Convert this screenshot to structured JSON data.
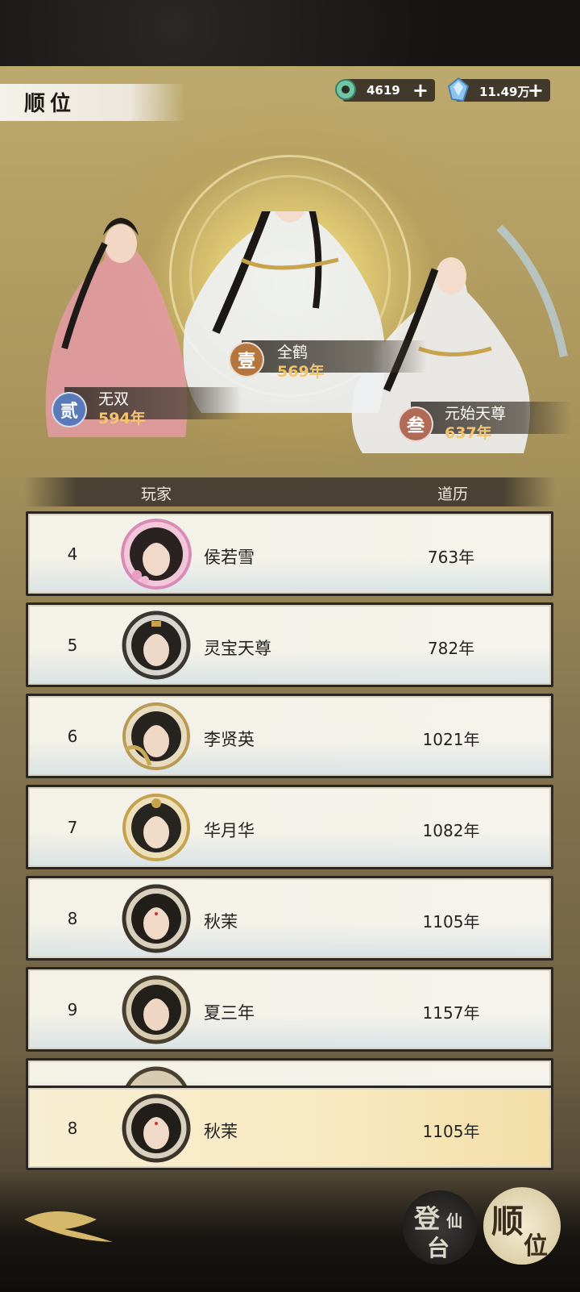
{
  "header": {
    "title": "顺位",
    "currencies": [
      {
        "icon": "jade-ring-icon",
        "value": "4619",
        "plus": "+"
      },
      {
        "icon": "spirit-crystal-icon",
        "value": "11.49万",
        "plus": "+"
      }
    ]
  },
  "podium": [
    {
      "medal": "壹",
      "name": "全鹤",
      "years": "569年",
      "accent": "#b5753f"
    },
    {
      "medal": "贰",
      "name": "无双",
      "years": "594年",
      "accent": "#5a79b8"
    },
    {
      "medal": "叁",
      "name": "元始天尊",
      "years": "637年",
      "accent": "#b06a55"
    }
  ],
  "table": {
    "col_player": "玩家",
    "col_years": "道历",
    "rows": [
      {
        "rank": "4",
        "name": "侯若雪",
        "years": "763年",
        "frame": "#d88bb5"
      },
      {
        "rank": "5",
        "name": "灵宝天尊",
        "years": "782年",
        "frame": "#3a3834"
      },
      {
        "rank": "6",
        "name": "李贤英",
        "years": "1021年",
        "frame": "#b99a55"
      },
      {
        "rank": "7",
        "name": "华月华",
        "years": "1082年",
        "frame": "#c4a24d"
      },
      {
        "rank": "8",
        "name": "秋茉",
        "years": "1105年",
        "frame": "#3a342b"
      },
      {
        "rank": "9",
        "name": "夏三年",
        "years": "1157年",
        "frame": "#4a4030"
      }
    ],
    "self_row": {
      "rank": "8",
      "name": "秋茉",
      "years": "1105年",
      "frame": "#3a342b"
    }
  },
  "bottom_nav": {
    "tab1": {
      "big": "登",
      "small1": "仙",
      "small2": "台"
    },
    "tab2": {
      "big1": "顺",
      "big2": "位"
    }
  }
}
